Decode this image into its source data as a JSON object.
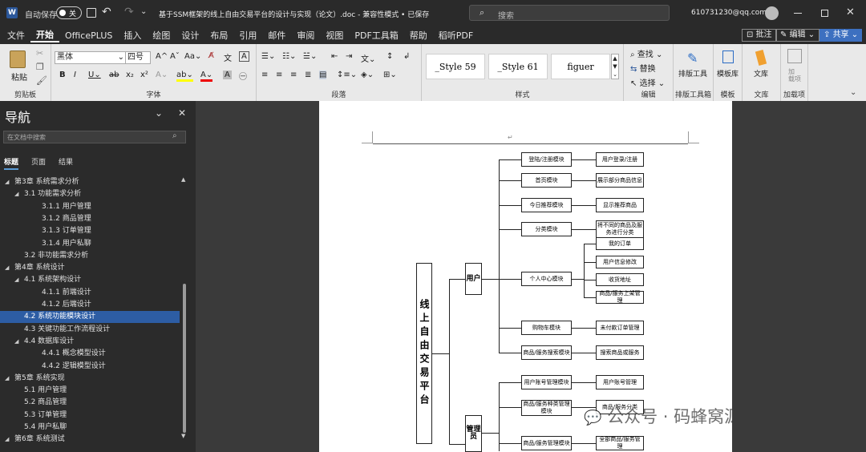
{
  "titlebar": {
    "autosave_label": "自动保存",
    "autosave_state": "关",
    "doc_title": "基于SSM框架的线上自由交易平台的设计与实现（论文）.doc  -  兼容性模式  •  已保存",
    "search_placeholder": "搜索",
    "user_email": "610731230@qq.com"
  },
  "menu": {
    "items": [
      "文件",
      "开始",
      "OfficePLUS",
      "插入",
      "绘图",
      "设计",
      "布局",
      "引用",
      "邮件",
      "审阅",
      "视图",
      "PDF工具箱",
      "帮助",
      "稻听PDF"
    ],
    "comment": "批注",
    "edit": "编辑",
    "share": "共享"
  },
  "ribbon": {
    "paste": "粘贴",
    "clipboard": "剪贴板",
    "font_name": "黑体",
    "font_size": "四号",
    "font_group": "字体",
    "paragraph_group": "段落",
    "styles": [
      "_Style 59",
      "_Style 61",
      "figuer"
    ],
    "styles_group": "样式",
    "find": "查找",
    "replace": "替换",
    "select": "选择",
    "edit_group": "编辑",
    "layout_tool": "排版工具",
    "layout_tool_group": "排版工具箱",
    "template_lib": "模板库",
    "template_group": "模板",
    "library": "文库",
    "library_group": "文库",
    "addin": "加载项",
    "addin_group": "加载项"
  },
  "nav": {
    "title": "导航",
    "search_placeholder": "在文档中搜索",
    "tabs": [
      "标题",
      "页面",
      "结果"
    ],
    "items": [
      {
        "t": "第3章 系统需求分析",
        "lv": 0,
        "exp": "◢"
      },
      {
        "t": "3.1 功能需求分析",
        "lv": 1,
        "exp": "◢"
      },
      {
        "t": "3.1.1 用户管理",
        "lv": 2,
        "exp": ""
      },
      {
        "t": "3.1.2 商品管理",
        "lv": 2,
        "exp": ""
      },
      {
        "t": "3.1.3 订单管理",
        "lv": 2,
        "exp": ""
      },
      {
        "t": "3.1.4 用户私聊",
        "lv": 2,
        "exp": ""
      },
      {
        "t": "3.2 非功能需求分析",
        "lv": 1,
        "exp": ""
      },
      {
        "t": "第4章 系统设计",
        "lv": 0,
        "exp": "◢"
      },
      {
        "t": "4.1 系统架构设计",
        "lv": 1,
        "exp": "◢"
      },
      {
        "t": "4.1.1 前端设计",
        "lv": 2,
        "exp": ""
      },
      {
        "t": "4.1.2 后端设计",
        "lv": 2,
        "exp": ""
      },
      {
        "t": "4.2 系统功能模块设计",
        "lv": 1,
        "exp": "",
        "sel": true
      },
      {
        "t": "4.3 关键功能工作流程设计",
        "lv": 1,
        "exp": ""
      },
      {
        "t": "4.4 数据库设计",
        "lv": 1,
        "exp": "◢"
      },
      {
        "t": "4.4.1 概念模型设计",
        "lv": 2,
        "exp": ""
      },
      {
        "t": "4.4.2 逻辑模型设计",
        "lv": 2,
        "exp": ""
      },
      {
        "t": "第5章 系统实现",
        "lv": 0,
        "exp": "◢"
      },
      {
        "t": "5.1 用户管理",
        "lv": 1,
        "exp": ""
      },
      {
        "t": "5.2 商品管理",
        "lv": 1,
        "exp": ""
      },
      {
        "t": "5.3 订单管理",
        "lv": 1,
        "exp": ""
      },
      {
        "t": "5.4 用户私聊",
        "lv": 1,
        "exp": ""
      },
      {
        "t": "第6章 系统测试",
        "lv": 0,
        "exp": "◢"
      }
    ]
  },
  "diagram": {
    "root": "线上自由交易平台",
    "user": "用户",
    "admin": "管理员",
    "user_modules": [
      {
        "m": "登陆/注册模块",
        "d": [
          "用户登录/注册"
        ]
      },
      {
        "m": "首页模块",
        "d": [
          "展示部分商品信息"
        ]
      },
      {
        "m": "今日推荐模块",
        "d": [
          "显示推荐商品"
        ]
      },
      {
        "m": "分类模块",
        "d": [
          "将不同的商品及服务进行分类"
        ]
      },
      {
        "m": "个人中心模块",
        "d": [
          "我的订单",
          "用户信息修改",
          "收货地址",
          "商品/服务上架管理"
        ]
      },
      {
        "m": "购物车模块",
        "d": [
          "未付款订单管理"
        ]
      },
      {
        "m": "商品/服务搜索模块",
        "d": [
          "搜索商品或服务"
        ]
      }
    ],
    "admin_modules": [
      {
        "m": "用户账号管理模块",
        "d": [
          "用户账号管理"
        ]
      },
      {
        "m": "商品/服务种类管理模块",
        "d": [
          "商品/服务分类"
        ]
      },
      {
        "m": "商品/服务管理模块",
        "d": [
          "全部商品/服务管理"
        ]
      }
    ]
  },
  "watermark": "公众号 · 码蜂窝源码"
}
